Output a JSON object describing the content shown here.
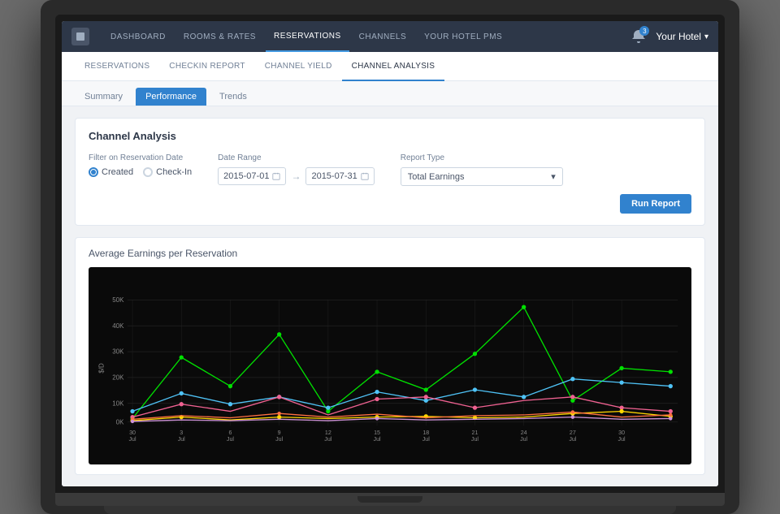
{
  "nav": {
    "logo_alt": "hotel-icon",
    "items": [
      {
        "label": "Dashboard",
        "id": "dashboard",
        "active": false
      },
      {
        "label": "Rooms & Rates",
        "id": "rooms-rates",
        "active": false
      },
      {
        "label": "Reservations",
        "id": "reservations",
        "active": true
      },
      {
        "label": "Channels",
        "id": "channels",
        "active": false
      },
      {
        "label": "Your Hotel PMS",
        "id": "hotel-pms",
        "active": false
      }
    ],
    "notification_count": "3",
    "hotel_name": "Your Hotel"
  },
  "sub_nav": {
    "items": [
      {
        "label": "Reservations",
        "id": "reservations",
        "active": false
      },
      {
        "label": "Checkin Report",
        "id": "checkin-report",
        "active": false
      },
      {
        "label": "Channel Yield",
        "id": "channel-yield",
        "active": false
      },
      {
        "label": "Channel Analysis",
        "id": "channel-analysis",
        "active": true
      }
    ]
  },
  "tabs": [
    {
      "label": "Summary",
      "id": "summary",
      "active": false
    },
    {
      "label": "Performance",
      "id": "performance",
      "active": true
    },
    {
      "label": "Trends",
      "id": "trends",
      "active": false
    }
  ],
  "filter_card": {
    "title": "Channel Analysis",
    "filter_label": "Filter on Reservation Date",
    "radio_options": [
      {
        "label": "Created",
        "value": "created",
        "selected": true
      },
      {
        "label": "Check-In",
        "value": "checkin",
        "selected": false
      }
    ],
    "date_range_label": "Date Range",
    "date_start": "2015-07-01",
    "date_end": "2015-07-31",
    "report_type_label": "Report Type",
    "report_type_value": "Total Earnings",
    "run_report_label": "Run Report"
  },
  "chart": {
    "title": "Average Earnings per Reservation",
    "y_axis_label": "$/D",
    "y_labels": [
      "50K",
      "40K",
      "30K",
      "20K",
      "10K",
      "0K"
    ],
    "x_labels": [
      {
        "val": "30",
        "sub": "Jul"
      },
      {
        "val": "3",
        "sub": "Jul"
      },
      {
        "val": "6",
        "sub": "Jul"
      },
      {
        "val": "9",
        "sub": "Jul"
      },
      {
        "val": "12",
        "sub": "Jul"
      },
      {
        "val": "15",
        "sub": "Jul"
      },
      {
        "val": "18",
        "sub": "Jul"
      },
      {
        "val": "21",
        "sub": "Jul"
      },
      {
        "val": "24",
        "sub": "Jul"
      },
      {
        "val": "27",
        "sub": "Jul"
      },
      {
        "val": "30",
        "sub": "Jul"
      }
    ]
  }
}
